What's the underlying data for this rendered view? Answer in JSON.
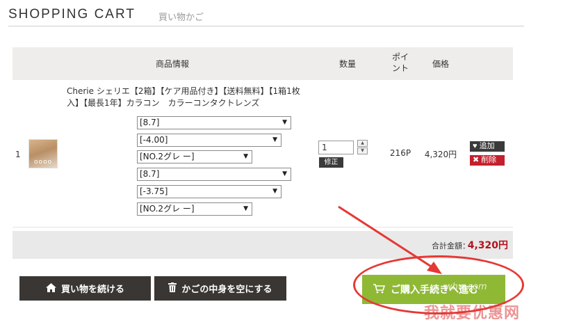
{
  "header": {
    "title_en": "SHOPPING CART",
    "title_jp": "買い物かご"
  },
  "table": {
    "headers": {
      "product_info": "商品情報",
      "quantity": "数量",
      "points": "ポイ\nント",
      "price": "価格"
    }
  },
  "cart_item": {
    "number": "1",
    "product_name": "Cherie シェリエ【2箱】【ケア用品付き】【送料無料】【1箱1枚入】【最長1年】カラコン　カラーコンタクトレンズ",
    "options": [
      "[8.7]",
      "[-4.00]",
      "[NO.2グレ ー]",
      "[8.7]",
      "[-3.75]",
      "[NO.2グレ ー]"
    ],
    "quantity": "1",
    "fix_label": "修正",
    "points": "216P",
    "price": "4,320円",
    "add_label": "追加",
    "delete_label": "削除",
    "thumb_text": "oooo"
  },
  "summary": {
    "total_label": "合計金額：",
    "total_value": "4,320円"
  },
  "actions": {
    "continue_label": "買い物を続ける",
    "empty_label": "かごの中身を空にする",
    "checkout_label": "ご購入手続きへ進む"
  },
  "watermark": {
    "site_text": "whw.com",
    "main_text": "我就要优惠网"
  },
  "colors": {
    "header_bg": "#efedeb",
    "dark_button": "#3a3633",
    "checkout_green": "#8fb935",
    "delete_red": "#c41f2c",
    "total_red": "#b3121e",
    "annotation_red": "#e53935"
  }
}
